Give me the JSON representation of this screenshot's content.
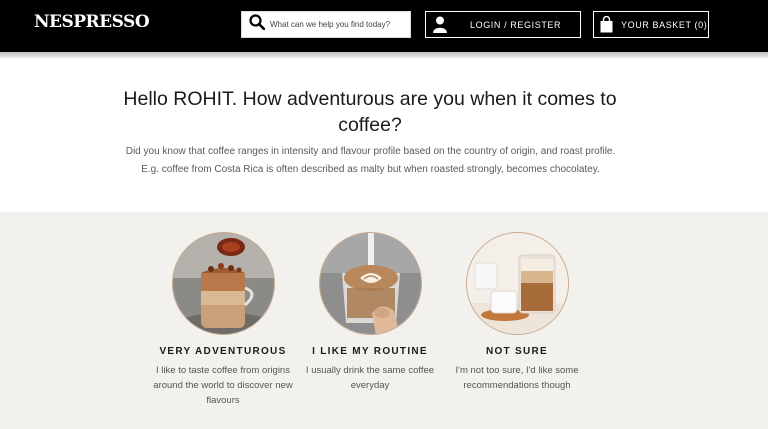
{
  "header": {
    "logo": "NESPRESSO",
    "search_placeholder": "What can we help you find today?",
    "login_label": "LOGIN / REGISTER",
    "basket_label": "YOUR BASKET (0)"
  },
  "intro": {
    "title": "Hello ROHIT. How adventurous are you when it comes to coffee?",
    "description": "Did you know that coffee ranges in intensity and flavour profile based on the country of origin, and roast profile. E.g. coffee from Costa Rica is often described as malty but when roasted strongly, becomes chocolatey."
  },
  "options": [
    {
      "title": "VERY ADVENTUROUS",
      "description": "I like to taste coffee from origins around the world to discover new flavours"
    },
    {
      "title": "I LIKE MY ROUTINE",
      "description": "I usually drink the same coffee everyday"
    },
    {
      "title": "NOT SURE",
      "description": "I'm not too sure, I'd like some recommendations though"
    }
  ],
  "icons": [
    "search-icon",
    "user-icon",
    "shopping-bag-icon"
  ]
}
